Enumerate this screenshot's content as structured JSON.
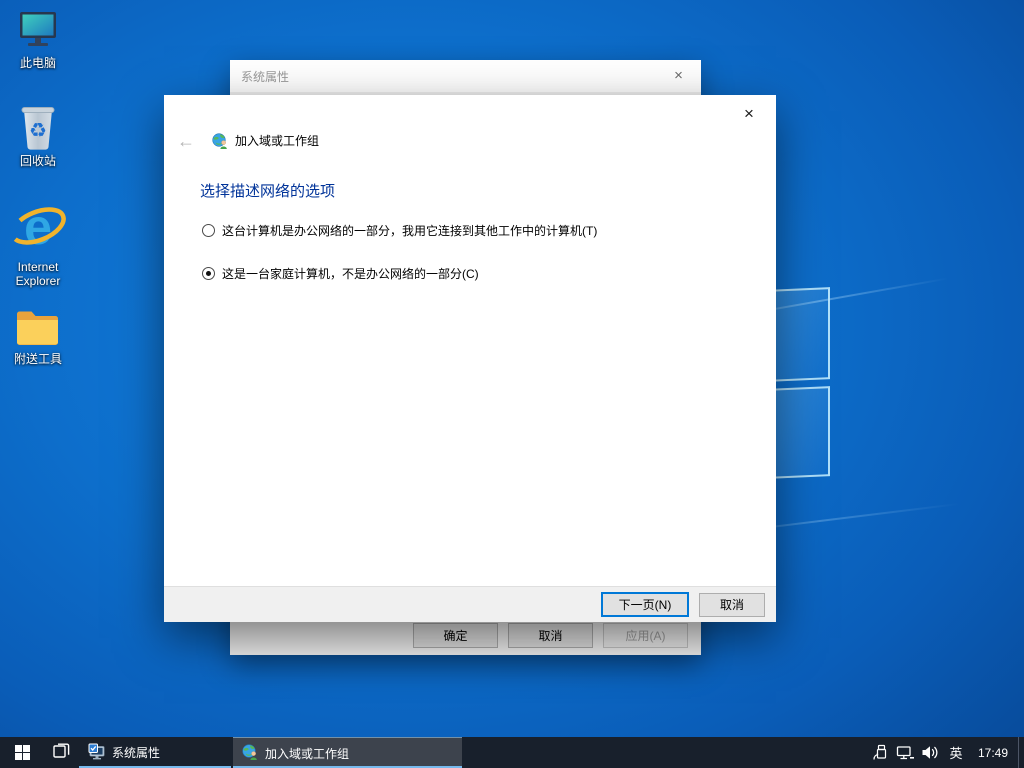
{
  "desktop": {
    "icons": [
      {
        "label": "此电脑"
      },
      {
        "label": "回收站"
      },
      {
        "label": "Internet Explorer"
      },
      {
        "label": "附送工具"
      }
    ]
  },
  "system_properties": {
    "title": "系统属性",
    "close_glyph": "×",
    "ok_button": "确定",
    "cancel_button": "取消",
    "apply_button": "应用(A)"
  },
  "wizard": {
    "title": "加入域或工作组",
    "back_glyph": "←",
    "close_glyph": "×",
    "heading": "选择描述网络的选项",
    "options": [
      {
        "label": "这台计算机是办公网络的一部分，我用它连接到其他工作中的计算机(T)",
        "selected": false
      },
      {
        "label": "这是一台家庭计算机，不是办公网络的一部分(C)",
        "selected": true
      }
    ],
    "next_button": "下一页(N)",
    "cancel_button": "取消"
  },
  "taskbar": {
    "buttons": [
      {
        "label": "系统属性",
        "active": false
      },
      {
        "label": "加入域或工作组",
        "active": true
      }
    ],
    "tray": {
      "ime_indicator": "英",
      "time": "17:49"
    }
  },
  "colors": {
    "accent": "#0078d7",
    "heading_blue": "#003399",
    "taskbar_underline": "#76b9ed",
    "taskbar_background": "#18202c"
  }
}
